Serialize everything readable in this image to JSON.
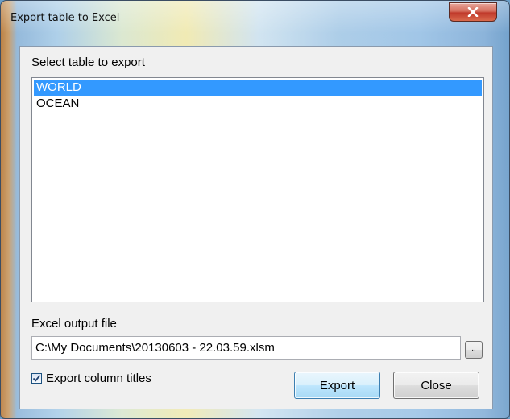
{
  "window": {
    "title": "Export table to Excel"
  },
  "table_select": {
    "label": "Select table to export",
    "items": [
      {
        "label": "WORLD",
        "selected": true
      },
      {
        "label": "OCEAN",
        "selected": false
      }
    ]
  },
  "output": {
    "label": "Excel output file",
    "value": "C:\\My Documents\\20130603 - 22.03.59.xlsm",
    "browse_label": ".."
  },
  "options": {
    "export_column_titles_label": "Export column titles",
    "export_column_titles_checked": true
  },
  "buttons": {
    "export_label": "Export",
    "close_label": "Close"
  },
  "colors": {
    "selection": "#3399ff",
    "close_button": "#c0392b"
  },
  "icons": {
    "close": "close-icon",
    "checkbox_check": "checkmark-icon"
  }
}
